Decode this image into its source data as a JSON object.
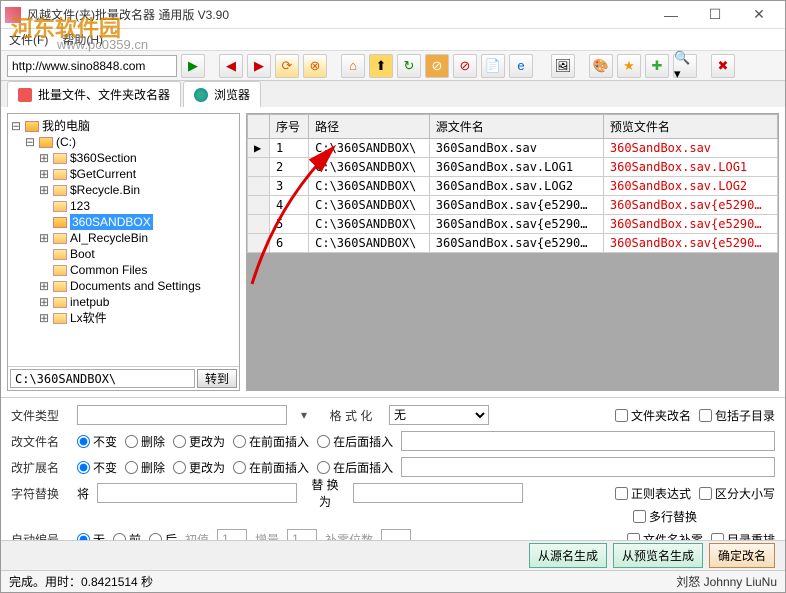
{
  "window": {
    "title": "风越文件(夹)批量改名器 通用版 V3.90",
    "minimize": "—",
    "maximize": "☐",
    "close": "✕"
  },
  "watermark": {
    "main": "河东软件园",
    "sub": "www.pc0359.cn"
  },
  "menu": {
    "file": "文件(F)",
    "help": "帮助(H)"
  },
  "address": {
    "url": "http://www.sino8848.com"
  },
  "toolbar_icons": [
    "▶",
    "◀",
    "▶",
    "⟳",
    "⟲",
    "⌂",
    "⬆",
    "↻",
    "⌫",
    "⊘",
    "⊘",
    "📄",
    "e",
    "🖼",
    "🎨",
    "★",
    "➕",
    "🔍",
    "✖"
  ],
  "tabs": {
    "renamer": "批量文件、文件夹改名器",
    "browser": "浏览器"
  },
  "tree": {
    "root": "我的电脑",
    "drive": "(C:)",
    "items": [
      "$360Section",
      "$GetCurrent",
      "$Recycle.Bin",
      "123",
      "360SANDBOX",
      "AI_RecycleBin",
      "Boot",
      "Common Files",
      "Documents and Settings",
      "inetpub",
      "Lx软件"
    ],
    "selected_index": 4
  },
  "path": {
    "value": "C:\\360SANDBOX\\",
    "go": "转到"
  },
  "grid": {
    "cols": [
      "序号",
      "路径",
      "源文件名",
      "预览文件名"
    ],
    "rows": [
      {
        "n": "1",
        "path": "C:\\360SANDBOX\\",
        "src": "360SandBox.sav",
        "pv": "360SandBox.sav"
      },
      {
        "n": "2",
        "path": "C:\\360SANDBOX\\",
        "src": "360SandBox.sav.LOG1",
        "pv": "360SandBox.sav.LOG1"
      },
      {
        "n": "3",
        "path": "C:\\360SANDBOX\\",
        "src": "360SandBox.sav.LOG2",
        "pv": "360SandBox.sav.LOG2"
      },
      {
        "n": "4",
        "path": "C:\\360SANDBOX\\",
        "src": "360SandBox.sav{e5290…",
        "pv": "360SandBox.sav{e5290…"
      },
      {
        "n": "5",
        "path": "C:\\360SANDBOX\\",
        "src": "360SandBox.sav{e5290…",
        "pv": "360SandBox.sav{e5290…"
      },
      {
        "n": "6",
        "path": "C:\\360SANDBOX\\",
        "src": "360SandBox.sav{e5290…",
        "pv": "360SandBox.sav{e5290…"
      }
    ]
  },
  "opts": {
    "filetype": "文件类型",
    "format_lbl": "格 式 化",
    "format_val": "无",
    "folder_rename": "文件夹改名",
    "include_sub": "包括子目录",
    "mod_name": "改文件名",
    "mod_ext": "改扩展名",
    "r_keep": "不变",
    "r_del": "删除",
    "r_chg": "更改为",
    "r_pre": "在前面插入",
    "r_suf": "在后面插入",
    "replace_lbl": "字符替换",
    "replace_from": "将",
    "replace_to": "替 换 为",
    "regex": "正则表达式",
    "case": "区分大小写",
    "multiline": "多行替换",
    "auto_lbl": "自动编号",
    "r_none": "无",
    "r_front": "前",
    "r_back": "后",
    "init": "初值",
    "init_v": "1",
    "step": "增量",
    "step_v": "1",
    "pad": "补零位数",
    "pad_v": "",
    "pad_name": "文件名补零",
    "dir_renum": "目录重排"
  },
  "buttons": {
    "gen_from_src": "从源名生成",
    "gen_from_pv": "从预览名生成",
    "confirm": "确定改名"
  },
  "status": {
    "text": "完成。用时：0.8421514 秒",
    "user": "刘怒 Johnny LiuNu"
  }
}
